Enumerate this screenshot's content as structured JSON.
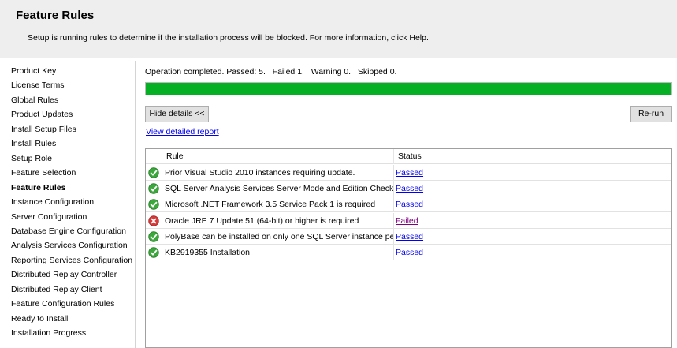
{
  "header": {
    "title": "Feature Rules",
    "description": "Setup is running rules to determine if the installation process will be blocked. For more information, click Help."
  },
  "sidebar": {
    "active_index": 8,
    "items": [
      {
        "label": "Product Key"
      },
      {
        "label": "License Terms"
      },
      {
        "label": "Global Rules"
      },
      {
        "label": "Product Updates"
      },
      {
        "label": "Install Setup Files"
      },
      {
        "label": "Install Rules"
      },
      {
        "label": "Setup Role"
      },
      {
        "label": "Feature Selection"
      },
      {
        "label": "Feature Rules"
      },
      {
        "label": "Instance Configuration"
      },
      {
        "label": "Server Configuration"
      },
      {
        "label": "Database Engine Configuration"
      },
      {
        "label": "Analysis Services Configuration"
      },
      {
        "label": "Reporting Services Configuration"
      },
      {
        "label": "Distributed Replay Controller"
      },
      {
        "label": "Distributed Replay Client"
      },
      {
        "label": "Feature Configuration Rules"
      },
      {
        "label": "Ready to Install"
      },
      {
        "label": "Installation Progress"
      }
    ]
  },
  "main": {
    "status_text": "Operation completed. Passed: 5.   Failed 1.   Warning 0.   Skipped 0.",
    "progress_fraction": 1.0,
    "progress_color": "#06b025",
    "hide_details_label": "Hide details <<",
    "rerun_label": "Re-run",
    "report_link_label": "View detailed report",
    "table": {
      "columns": {
        "rule": "Rule",
        "status": "Status"
      },
      "rows": [
        {
          "rule": "Prior Visual Studio 2010 instances requiring update.",
          "status": "Passed",
          "icon": "check-icon"
        },
        {
          "rule": "SQL Server Analysis Services Server Mode and Edition Check",
          "status": "Passed",
          "icon": "check-icon"
        },
        {
          "rule": "Microsoft .NET Framework 3.5 Service Pack 1 is required",
          "status": "Passed",
          "icon": "check-icon"
        },
        {
          "rule": "Oracle JRE 7 Update 51 (64-bit) or higher is required",
          "status": "Failed",
          "icon": "error-icon"
        },
        {
          "rule": "PolyBase can be installed on only one SQL Server instance per c...",
          "status": "Passed",
          "icon": "check-icon"
        },
        {
          "rule": "KB2919355 Installation",
          "status": "Passed",
          "icon": "check-icon"
        }
      ]
    },
    "colors": {
      "passed_link": "#0000ee",
      "failed_link": "#800080",
      "check": "#3aa83a",
      "error": "#d83b3b"
    }
  }
}
